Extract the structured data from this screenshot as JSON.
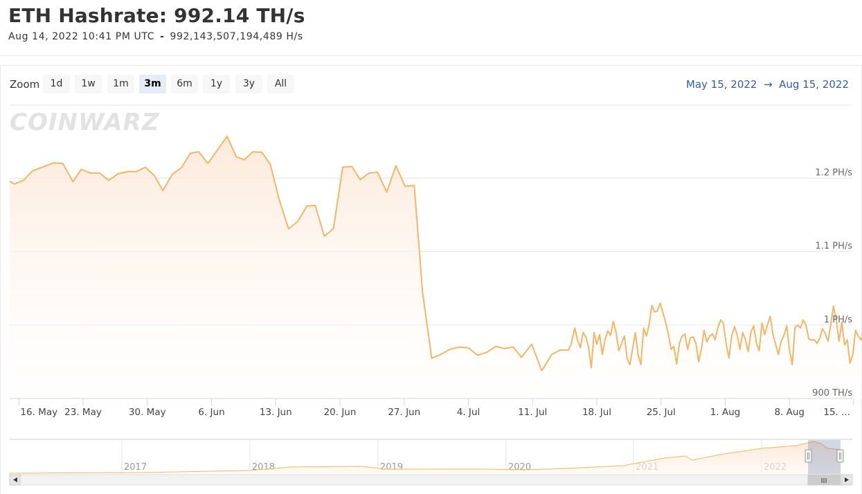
{
  "header": {
    "title": "ETH Hashrate: 992.14 TH/s",
    "timestamp": "Aug 14, 2022 10:41 PM UTC",
    "separator": "-",
    "exact_value": "992,143,507,194,489 H/s"
  },
  "toolbar": {
    "zoom_label": "Zoom",
    "buttons": [
      "1d",
      "1w",
      "1m",
      "3m",
      "6m",
      "1y",
      "3y",
      "All"
    ],
    "active": "3m",
    "range_from": "May 15, 2022",
    "range_arrow": "→",
    "range_to": "Aug 15, 2022"
  },
  "watermark": "COINWARZ",
  "colors": {
    "line": "#f5b563",
    "fill_top": "#fbe3cf",
    "fill_bottom": "#ffffff",
    "range_text": "#335cad"
  },
  "chart_data": {
    "type": "area",
    "unit": "TH/s",
    "ylim": [
      900,
      1200
    ],
    "yticks": [
      {
        "v": 900,
        "label": "900 TH/s"
      },
      {
        "v": 1000,
        "label": "1 PH/s"
      },
      {
        "v": 1100,
        "label": "1.1 PH/s"
      },
      {
        "v": 1200,
        "label": "1.2 PH/s"
      }
    ],
    "xticks": [
      "16. May",
      "23. May",
      "30. May",
      "6. Jun",
      "13. Jun",
      "20. Jun",
      "27. Jun",
      "4. Jul",
      "11. Jul",
      "18. Jul",
      "25. Jul",
      "1. Aug",
      "8. Aug",
      "15. ..."
    ],
    "x_day_start": "May 15, 2022",
    "series": [
      {
        "name": "",
        "points": [
          [
            0,
            1196
          ],
          [
            0.5,
            1192
          ],
          [
            1.5,
            1197
          ],
          [
            2.5,
            1210
          ],
          [
            4,
            1217
          ],
          [
            4.8,
            1221
          ],
          [
            5.8,
            1220
          ],
          [
            6.9,
            1195
          ],
          [
            7.8,
            1212
          ],
          [
            8.8,
            1207
          ],
          [
            9.8,
            1207
          ],
          [
            10.8,
            1197
          ],
          [
            11.8,
            1206
          ],
          [
            12.9,
            1209
          ],
          [
            13.8,
            1209
          ],
          [
            14.8,
            1215
          ],
          [
            15.8,
            1203
          ],
          [
            16.7,
            1183
          ],
          [
            17.7,
            1205
          ],
          [
            18.7,
            1214
          ],
          [
            19.7,
            1234
          ],
          [
            20.6,
            1236
          ],
          [
            21.6,
            1220
          ],
          [
            23.7,
            1257
          ],
          [
            24.7,
            1229
          ],
          [
            25.6,
            1225
          ],
          [
            26.5,
            1236
          ],
          [
            27.5,
            1235
          ],
          [
            28.4,
            1219
          ],
          [
            29.4,
            1170
          ],
          [
            30.4,
            1131
          ],
          [
            31.4,
            1141
          ],
          [
            32.4,
            1162
          ],
          [
            33.3,
            1163
          ],
          [
            34.3,
            1121
          ],
          [
            34.9,
            1127
          ],
          [
            35.3,
            1132
          ],
          [
            36.3,
            1215
          ],
          [
            37.3,
            1216
          ],
          [
            38.2,
            1198
          ],
          [
            39.2,
            1207
          ],
          [
            40.1,
            1208
          ],
          [
            41.1,
            1181
          ],
          [
            42.1,
            1217
          ],
          [
            43.1,
            1189
          ],
          [
            44.1,
            1190
          ],
          [
            45.0,
            1045
          ],
          [
            46.0,
            955
          ],
          [
            47.0,
            960
          ],
          [
            48.0,
            967
          ],
          [
            49.0,
            970
          ],
          [
            50.0,
            969
          ],
          [
            51.0,
            959
          ],
          [
            52.0,
            963
          ],
          [
            53.0,
            971
          ],
          [
            53.9,
            968
          ],
          [
            54.9,
            970
          ],
          [
            55.8,
            956
          ],
          [
            56.9,
            974
          ],
          [
            58.0,
            938
          ],
          [
            59.1,
            960
          ],
          [
            60.0,
            966
          ],
          [
            60.9,
            966
          ],
          [
            61.2,
            974
          ],
          [
            61.6,
            996
          ],
          [
            61.9,
            980
          ],
          [
            62.2,
            969
          ],
          [
            62.5,
            990
          ],
          [
            62.8,
            984
          ],
          [
            63.1,
            970
          ],
          [
            63.4,
            942
          ],
          [
            63.7,
            990
          ],
          [
            64.0,
            974
          ],
          [
            64.3,
            987
          ],
          [
            64.6,
            960
          ],
          [
            64.9,
            980
          ],
          [
            65.2,
            992
          ],
          [
            65.5,
            986
          ],
          [
            65.8,
            1005
          ],
          [
            66.1,
            990
          ],
          [
            66.4,
            965
          ],
          [
            66.7,
            975
          ],
          [
            67.0,
            985
          ],
          [
            67.3,
            955
          ],
          [
            67.6,
            946
          ],
          [
            67.9,
            968
          ],
          [
            68.2,
            990
          ],
          [
            68.5,
            960
          ],
          [
            68.8,
            946
          ],
          [
            69.1,
            996
          ],
          [
            69.4,
            985
          ],
          [
            69.7,
            1000
          ],
          [
            70.0,
            1027
          ],
          [
            70.3,
            1018
          ],
          [
            70.6,
            1019
          ],
          [
            70.9,
            1030
          ],
          [
            71.2,
            1017
          ],
          [
            71.5,
            1004
          ],
          [
            71.8,
            988
          ],
          [
            72.1,
            967
          ],
          [
            72.4,
            971
          ],
          [
            72.7,
            947
          ],
          [
            73.0,
            975
          ],
          [
            73.3,
            985
          ],
          [
            73.6,
            988
          ],
          [
            73.9,
            967
          ],
          [
            74.2,
            983
          ],
          [
            74.5,
            984
          ],
          [
            74.8,
            975
          ],
          [
            75.1,
            950
          ],
          [
            75.4,
            968
          ],
          [
            75.7,
            993
          ],
          [
            76.0,
            977
          ],
          [
            76.3,
            985
          ],
          [
            76.6,
            988
          ],
          [
            76.9,
            980
          ],
          [
            77.2,
            997
          ],
          [
            77.5,
            1007
          ],
          [
            77.8,
            1002
          ],
          [
            78.1,
            975
          ],
          [
            78.4,
            955
          ],
          [
            78.7,
            985
          ],
          [
            79.0,
            998
          ],
          [
            79.3,
            987
          ],
          [
            79.6,
            967
          ],
          [
            79.9,
            990
          ],
          [
            80.2,
            980
          ],
          [
            80.5,
            964
          ],
          [
            80.8,
            990
          ],
          [
            81.1,
            999
          ],
          [
            81.4,
            975
          ],
          [
            81.7,
            965
          ],
          [
            82.0,
            1003
          ],
          [
            82.3,
            987
          ],
          [
            82.6,
            1000
          ],
          [
            82.9,
            1012
          ],
          [
            83.2,
            987
          ],
          [
            83.5,
            973
          ],
          [
            83.8,
            960
          ],
          [
            84.1,
            978
          ],
          [
            84.4,
            986
          ],
          [
            84.7,
            999
          ],
          [
            85.0,
            966
          ],
          [
            85.3,
            946
          ],
          [
            85.6,
            997
          ],
          [
            85.9,
            1000
          ],
          [
            86.2,
            996
          ],
          [
            86.5,
            1007
          ],
          [
            86.8,
            1000
          ],
          [
            87.1,
            981
          ],
          [
            87.4,
            980
          ],
          [
            87.7,
            980
          ],
          [
            88.0,
            975
          ],
          [
            88.3,
            982
          ],
          [
            88.6,
            995
          ],
          [
            88.9,
            989
          ],
          [
            89.2,
            978
          ],
          [
            89.5,
            1001
          ],
          [
            89.8,
            1026
          ],
          [
            90.1,
            1007
          ],
          [
            90.4,
            978
          ],
          [
            90.7,
            1004
          ],
          [
            91.0,
            973
          ],
          [
            91.3,
            980
          ],
          [
            91.6,
            948
          ],
          [
            91.9,
            960
          ],
          [
            92.2,
            993
          ],
          [
            92.5,
            985
          ],
          [
            92.8,
            980
          ],
          [
            93.1,
            990
          ],
          [
            93.4,
            1003
          ],
          [
            93.7,
            997
          ],
          [
            94.0,
            978
          ],
          [
            94.3,
            993
          ],
          [
            94.6,
            963
          ],
          [
            94.9,
            1026
          ],
          [
            95.2,
            1000
          ],
          [
            95.5,
            1003
          ],
          [
            95.8,
            1022
          ],
          [
            96.1,
            1002
          ],
          [
            96.4,
            1006
          ],
          [
            96.7,
            1042
          ],
          [
            97.0,
            1042
          ],
          [
            97.3,
            1027
          ],
          [
            97.6,
            1008
          ]
        ]
      }
    ],
    "navigator": {
      "labels": [
        "2017",
        "2018",
        "2019",
        "2020",
        "2021",
        "2022"
      ],
      "scrollbar_grip": "III"
    }
  }
}
